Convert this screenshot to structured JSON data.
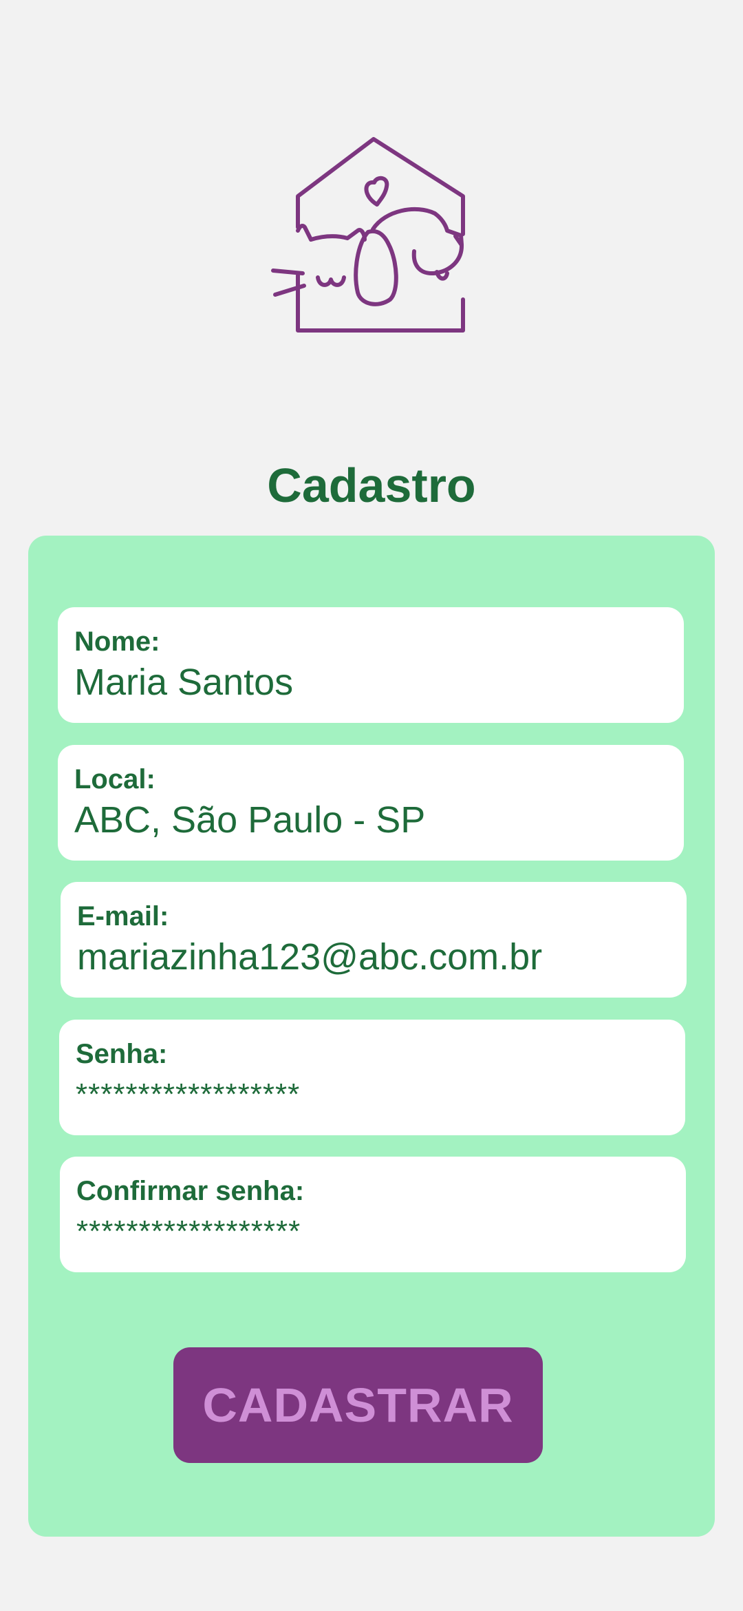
{
  "logo": {
    "icon": "pet-house-icon",
    "color": "#7d3680"
  },
  "header": {
    "title": "Cadastro"
  },
  "form": {
    "fields": [
      {
        "label": "Nome:",
        "value": "Maria Santos"
      },
      {
        "label": "Local:",
        "value": "ABC, São Paulo - SP"
      },
      {
        "label": "E-mail:",
        "value": "mariazinha123@abc.com.br"
      },
      {
        "label": "Senha:",
        "value": "******************"
      },
      {
        "label": "Confirmar senha:",
        "value": "******************"
      }
    ],
    "submit_label": "CADASTRAR"
  },
  "colors": {
    "background": "#f2f2f2",
    "card": "#a3f2c1",
    "text": "#1e6b3a",
    "button": "#7d3680",
    "button_text": "#cf8fd6"
  }
}
